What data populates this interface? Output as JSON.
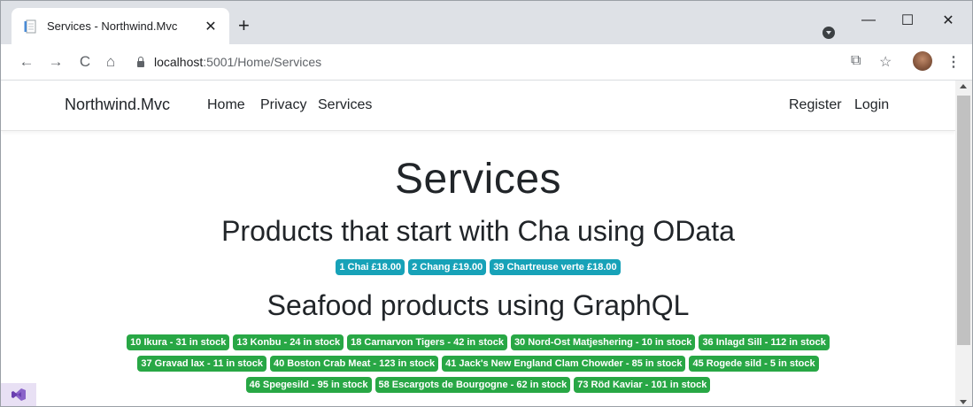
{
  "browser": {
    "tab_title": "Services - Northwind.Mvc",
    "tab_close": "✕",
    "new_tab": "+",
    "window_controls": {
      "minimize": "—",
      "maximize": "☐",
      "close": "✕"
    },
    "nav": {
      "back": "←",
      "forward": "→",
      "reload": "C",
      "home": "⌂"
    },
    "url_host": "localhost",
    "url_path": ":5001/Home/Services",
    "toolbar_icons": [
      "open-in-new-icon",
      "star-icon",
      "avatar",
      "menu-icon"
    ],
    "icon_glyphs": {
      "open_external": "⧉",
      "star": "☆",
      "menu": "⋮"
    }
  },
  "navbar": {
    "brand": "Northwind.Mvc",
    "left_links": [
      "Home",
      "Privacy",
      "Services"
    ],
    "right_links": [
      "Register",
      "Login"
    ]
  },
  "main": {
    "title": "Services",
    "odata_heading": "Products that start with Cha using OData",
    "odata_products": [
      "1 Chai £18.00",
      "2 Chang £19.00",
      "39 Chartreuse verte £18.00"
    ],
    "graphql_heading": "Seafood products using GraphQL",
    "graphql_rows": [
      [
        "10 Ikura - 31 in stock",
        "13 Konbu - 24 in stock",
        "18 Carnarvon Tigers - 42 in stock",
        "30 Nord-Ost Matjeshering - 10 in stock",
        "36 Inlagd Sill - 112 in stock"
      ],
      [
        "37 Gravad lax - 11 in stock",
        "40 Boston Crab Meat - 123 in stock",
        "41 Jack's New England Clam Chowder - 85 in stock",
        "45 Rogede sild - 5 in stock"
      ],
      [
        "46 Spegesild - 95 in stock",
        "58 Escargots de Bourgogne - 62 in stock",
        "73 Röd Kaviar - 101 in stock"
      ]
    ]
  },
  "colors": {
    "badge_info": "#17a2b8",
    "badge_success": "#28a745",
    "tabstrip": "#dee1e6"
  }
}
